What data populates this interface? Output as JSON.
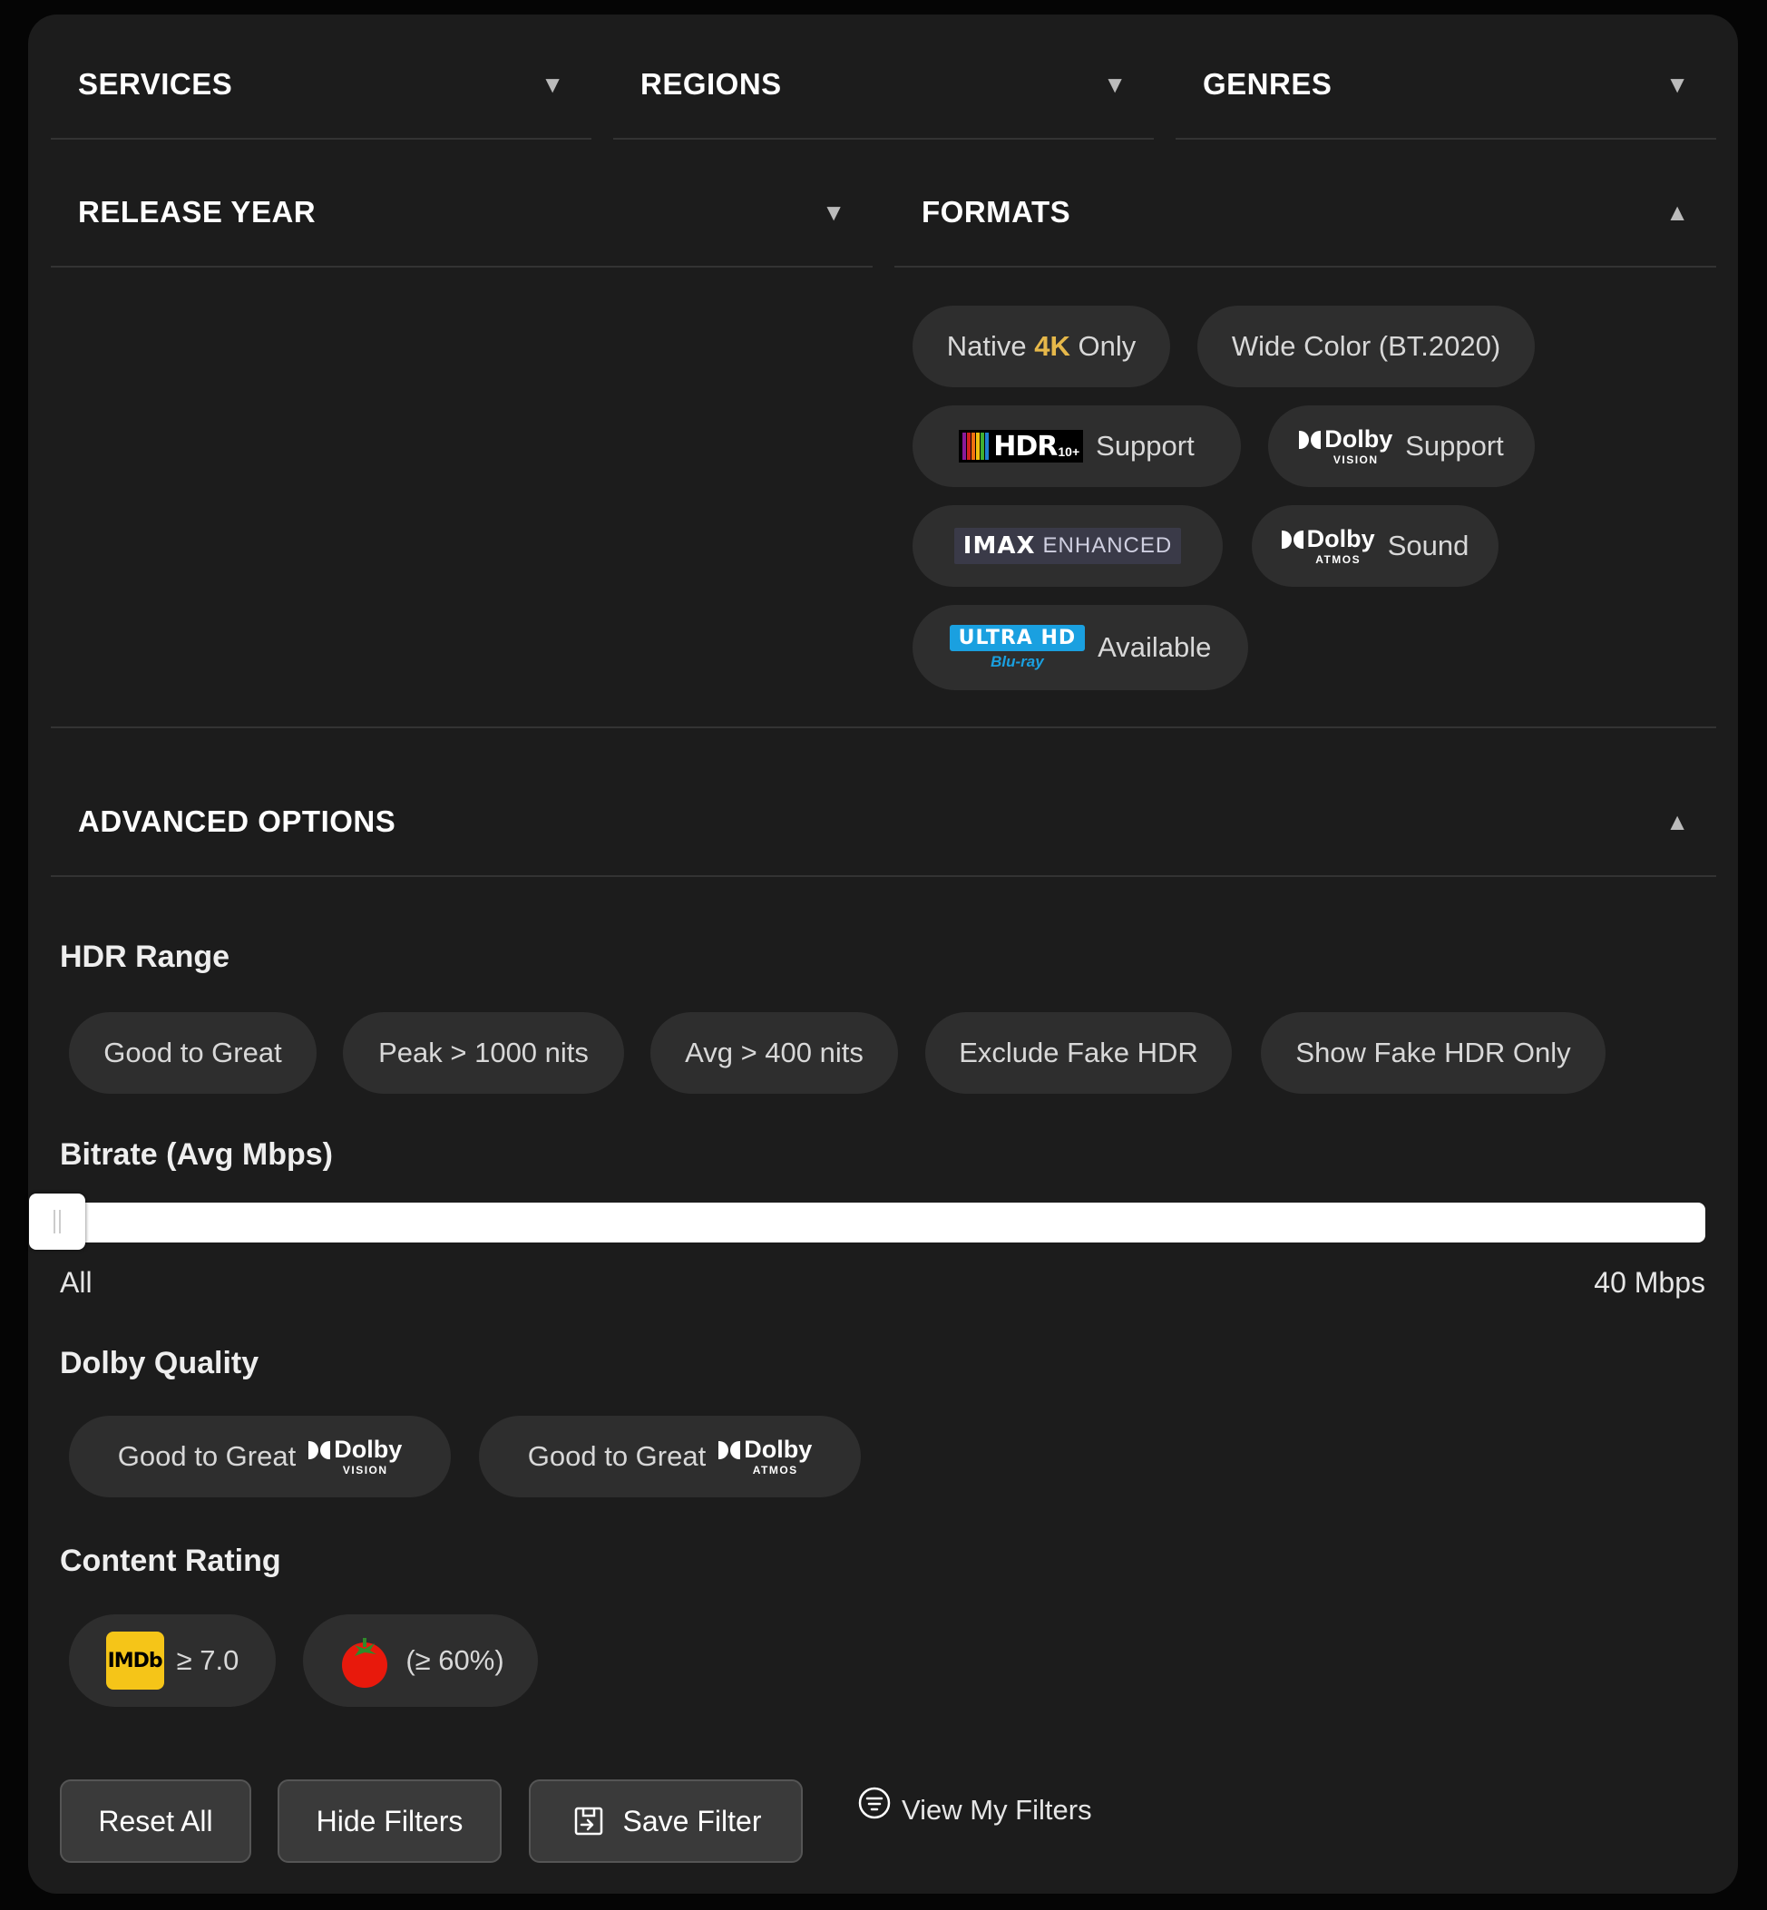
{
  "filters": {
    "services": "SERVICES",
    "regions": "REGIONS",
    "genres": "GENRES",
    "release_year": "RELEASE YEAR",
    "formats": "FORMATS",
    "collapsed_arrow": "▼",
    "expanded_arrow": "▲"
  },
  "formats": {
    "native_prefix": "Native ",
    "native_highlight": "4K",
    "native_suffix": " Only",
    "wide_color": "Wide Color (BT.2020)",
    "hdr10_label": "Support",
    "hdr10_logo_text": "HDR",
    "hdr10_logo_sub": "10+",
    "dolby_vision_label": "Support",
    "imax_logo_a": "IMAX",
    "imax_logo_b": "ENHANCED",
    "dolby_atmos_label": "Sound",
    "uhd_logo_top": "ULTRA HD",
    "uhd_logo_bottom": "Blu-ray",
    "uhd_label": "Available"
  },
  "dolby": {
    "word": "Dolby",
    "vision": "VISION",
    "atmos": "ATMOS"
  },
  "advanced": {
    "title": "ADVANCED OPTIONS",
    "hdr_range_title": "HDR Range",
    "hdr_options": [
      "Good to Great",
      "Peak > 1000 nits",
      "Avg > 400 nits",
      "Exclude Fake HDR",
      "Show Fake HDR Only"
    ],
    "bitrate_title": "Bitrate (Avg Mbps)",
    "bitrate_min_label": "All",
    "bitrate_max_label": "40 Mbps",
    "bitrate_value_fraction": 0.0,
    "dolby_quality_title": "Dolby Quality",
    "dolby_quality_prefix": "Good to Great",
    "content_rating_title": "Content Rating",
    "imdb_logo": "IMDb",
    "imdb_label": "≥ 7.0",
    "rt_label": "(≥ 60%)"
  },
  "actions": {
    "reset": "Reset All",
    "hide": "Hide Filters",
    "save": "Save Filter",
    "view": "View My Filters"
  }
}
